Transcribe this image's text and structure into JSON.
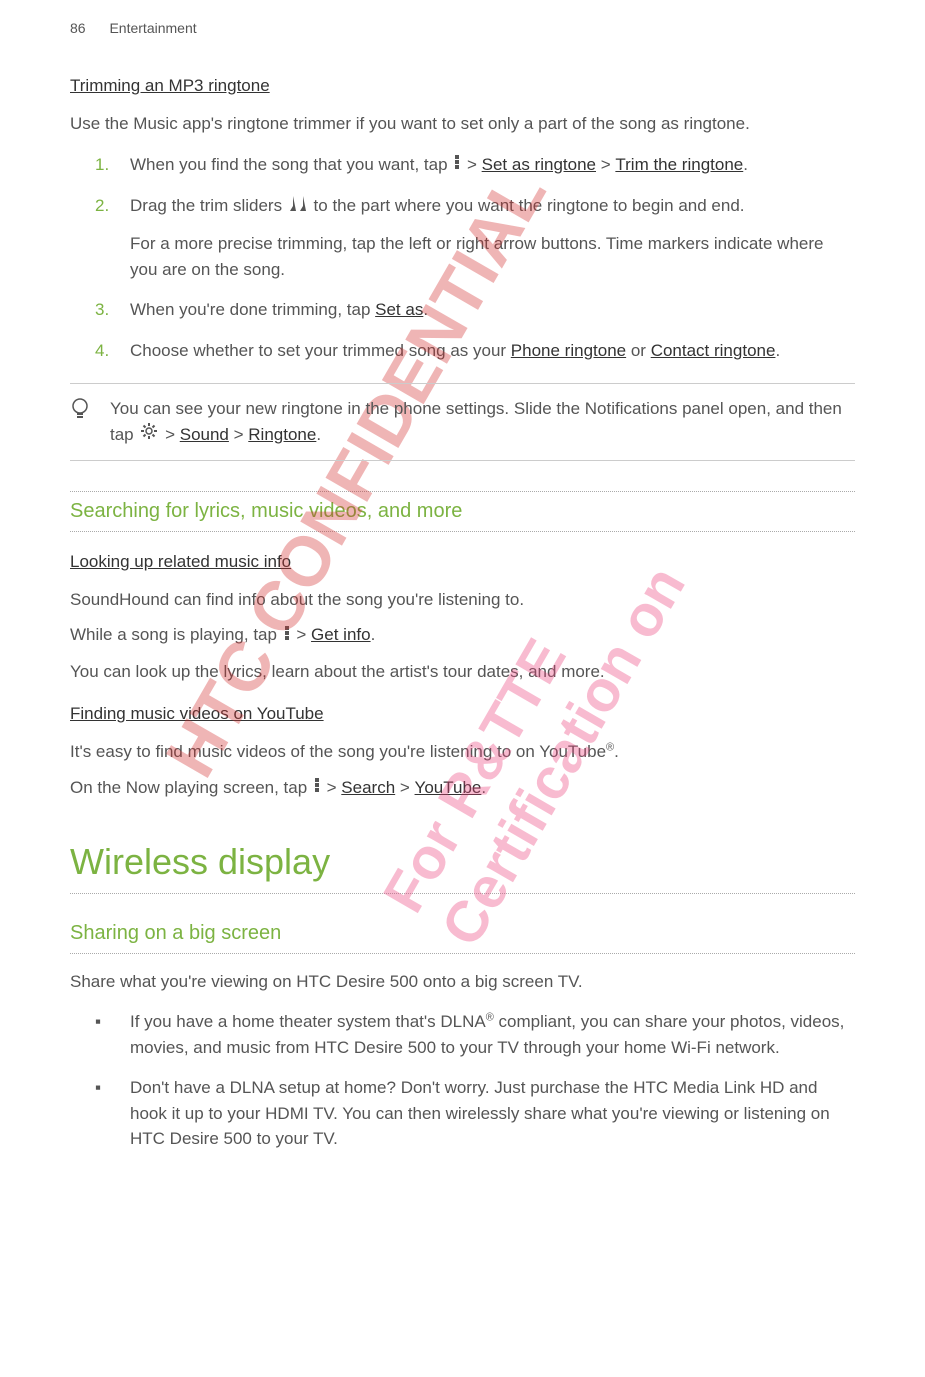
{
  "header": {
    "page": "86",
    "section": "Entertainment"
  },
  "h1": "Trimming an MP3 ringtone",
  "intro": "Use the Music app's ringtone trimmer if you want to set only a part of the song as ringtone.",
  "steps": [
    {
      "num": "1.",
      "pre": "When you find the song that you want, tap ",
      "gt1": " > ",
      "b1": "Set as ringtone",
      "gt2": " > ",
      "b2": "Trim the ringtone",
      "post": "."
    },
    {
      "num": "2.",
      "pre": "Drag the trim sliders ",
      "post": " to the part where you want the ringtone to begin and end.",
      "extra": "For a more precise trimming, tap the left or right arrow buttons. Time markers indicate where you are on the song."
    },
    {
      "num": "3.",
      "pre": "When you're done trimming, tap ",
      "b1": "Set as",
      "post": "."
    },
    {
      "num": "4.",
      "pre": "Choose whether to set your trimmed song as your ",
      "b1": "Phone ringtone",
      "mid": " or ",
      "b2": "Contact ringtone",
      "post": "."
    }
  ],
  "tip": {
    "pre": "You can see your new ringtone in the phone settings. Slide the Notifications panel open, and then tap ",
    "gt1": " > ",
    "b1": "Sound",
    "gt2": " > ",
    "b2": "Ringtone",
    "post": "."
  },
  "sub1": "Searching for lyrics, music videos, and more",
  "look_h": "Looking up related music info",
  "look_p1": "SoundHound can find info about the song you're listening to.",
  "look_p2_pre": "While a song is playing, tap ",
  "look_p2_gt": " > ",
  "look_p2_b": "Get info",
  "look_p2_post": ".",
  "look_p3": "You can look up the lyrics, learn about the artist's tour dates, and more.",
  "yt_h": "Finding music videos on YouTube",
  "yt_p1_pre": "It's easy to find music videos of the song you're listening to on YouTube",
  "yt_p1_post": ".",
  "yt_p2_pre": "On the Now playing screen, tap ",
  "yt_p2_gt": " > ",
  "yt_p2_b1": "Search",
  "yt_p2_gt2": " > ",
  "yt_p2_b2": "YouTube",
  "yt_p2_post": ".",
  "big": "Wireless display",
  "sub2": "Sharing on a big screen",
  "share_p": "Share what you're viewing on HTC Desire 500 onto a big screen TV.",
  "bullets": [
    {
      "pre": "If you have a home theater system that's DLNA",
      "post": " compliant, you can share your photos, videos, movies, and music from HTC Desire 500 to your TV through your home Wi-Fi network."
    },
    {
      "pre": "Don't have a DLNA setup at home? Don't worry. Just purchase the HTC Media Link HD and hook it up to your HDMI TV. You can then wirelessly share what you're viewing or listening on HTC Desire 500 to your TV."
    }
  ],
  "watermark1": "HTC CONFIDENTIAL",
  "watermark2": "For R&TTE Certification on"
}
